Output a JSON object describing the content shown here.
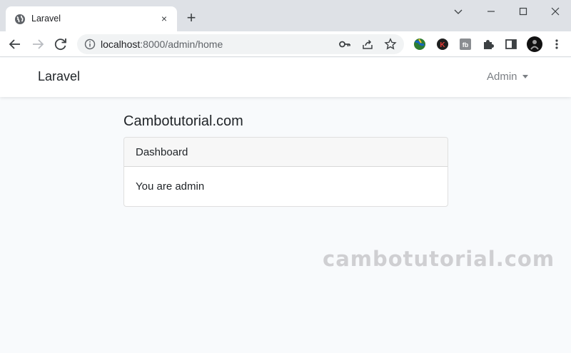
{
  "browser": {
    "tab_title": "Laravel",
    "tab_close": "×",
    "new_tab": "+",
    "url_host": "localhost",
    "url_path": ":8000/admin/home",
    "window_controls": {
      "minimize": "—",
      "maximize": "☐",
      "close": "✕",
      "tab_search": "⌄"
    }
  },
  "navbar": {
    "brand": "Laravel",
    "user_menu": "Admin"
  },
  "main": {
    "site_title": "Cambotutorial.com",
    "card": {
      "header": "Dashboard",
      "body": "You are admin"
    }
  },
  "watermark": "cambotutorial.com",
  "colors": {
    "tabbar_bg": "#dee1e6",
    "page_bg": "#f8fafc",
    "navbar_bg": "#ffffff",
    "card_header_bg": "#f7f7f7",
    "watermark": "#cfcfd2"
  }
}
